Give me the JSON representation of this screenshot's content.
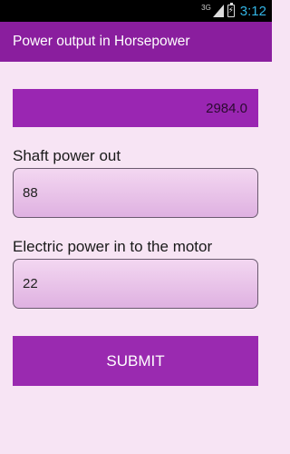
{
  "status_bar": {
    "network": "3G",
    "time": "3:12",
    "battery_text": "⚡"
  },
  "app_bar": {
    "title": "Power output in Horsepower"
  },
  "result": {
    "value": "2984.0"
  },
  "shaft": {
    "label": "Shaft power out",
    "value": "88"
  },
  "electric": {
    "label": "Electric power in to the motor",
    "value": "22"
  },
  "submit": {
    "label": "SUBMIT"
  },
  "colors": {
    "app_bar": "#8a1e9e",
    "accent": "#9a2ab0",
    "background": "#f7e4f4",
    "clock": "#33b5e5"
  },
  "icons": {
    "signal": "signal-icon",
    "battery": "battery-icon"
  }
}
